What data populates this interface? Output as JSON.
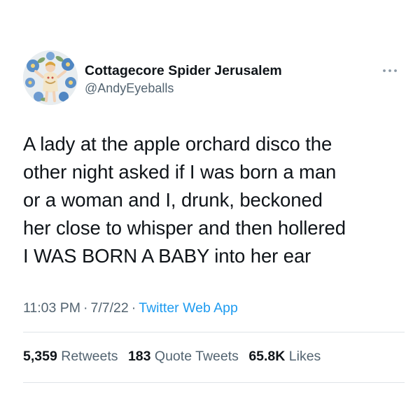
{
  "user": {
    "display_name": "Cottagecore Spider Jerusalem",
    "handle": "@AndyEyeballs"
  },
  "tweet": {
    "text": "A lady at the apple orchard disco the\nother night asked if I was born a man\nor a woman and I, drunk, beckoned\nher close to whisper and then hollered\nI WAS BORN A BABY into her ear",
    "time": "11:03 PM",
    "date": "7/7/22",
    "separator": "·",
    "source": "Twitter Web App"
  },
  "stats": {
    "retweets": {
      "count": "5,359",
      "label": "Retweets"
    },
    "quotes": {
      "count": "183",
      "label": "Quote Tweets"
    },
    "likes": {
      "count": "65.8K",
      "label": "Likes"
    }
  },
  "icons": {
    "more": "more-horizontal-icon"
  },
  "colors": {
    "text": "#0f1419",
    "secondary": "#536471",
    "link": "#1d9bf0",
    "divider": "#dfe4e8"
  }
}
